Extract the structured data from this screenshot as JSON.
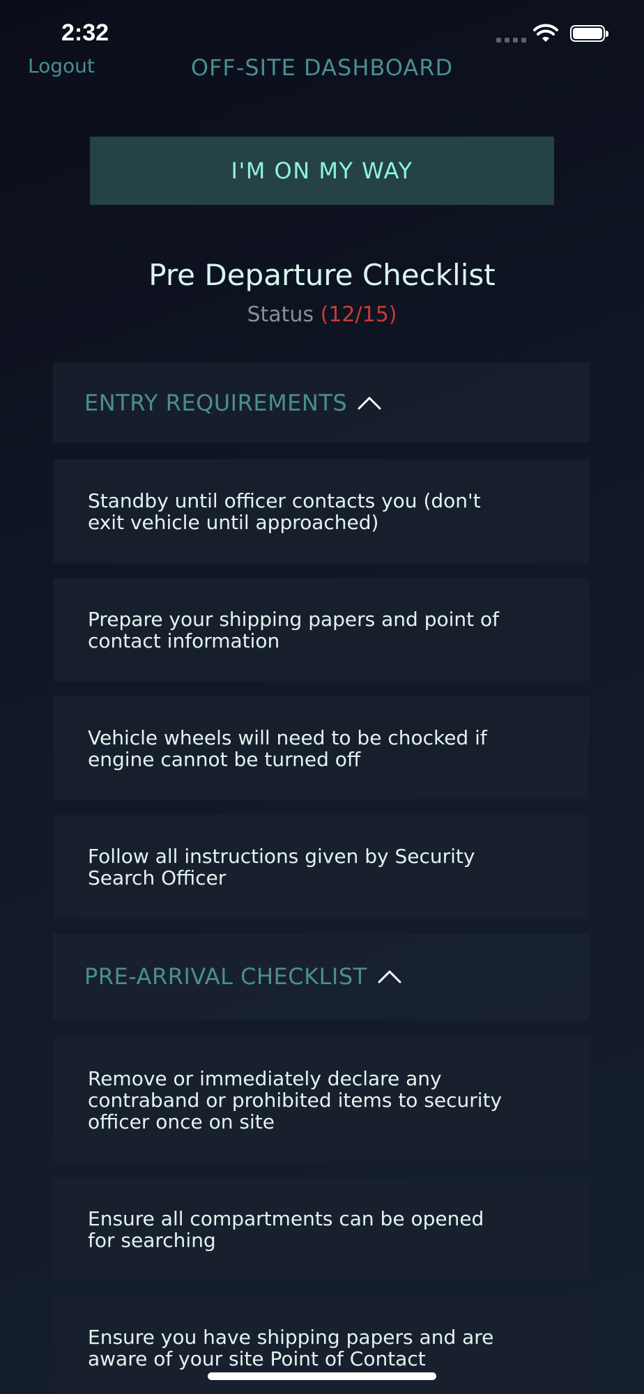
{
  "status_bar": {
    "time": "2:32"
  },
  "nav": {
    "logout_label": "Logout",
    "title": "OFF-SITE DASHBOARD"
  },
  "action_button_label": "I'M ON MY WAY",
  "checklist": {
    "title": "Pre Departure Checklist",
    "status_label": "Status",
    "status_value": "(12/15)",
    "status_color": "#c93a3a"
  },
  "sections": [
    {
      "header": "ENTRY REQUIREMENTS",
      "items": [
        "Standby until officer contacts you (don't exit vehicle until approached)",
        "Prepare your shipping papers and point of contact information",
        "Vehicle wheels will need to be chocked if engine cannot be turned off",
        "Follow all instructions given by Security Search Officer"
      ]
    },
    {
      "header": "PRE-ARRIVAL CHECKLIST",
      "items": [
        "Remove or immediately declare any contraband or prohibited items to security officer once on site",
        "Ensure all compartments can be opened for searching",
        "Ensure you have shipping papers and are aware of your site Point of Contact"
      ]
    }
  ],
  "colors": {
    "accent": "#4a8e91",
    "button_bg": "#254244",
    "button_text": "#8ef2e4"
  }
}
